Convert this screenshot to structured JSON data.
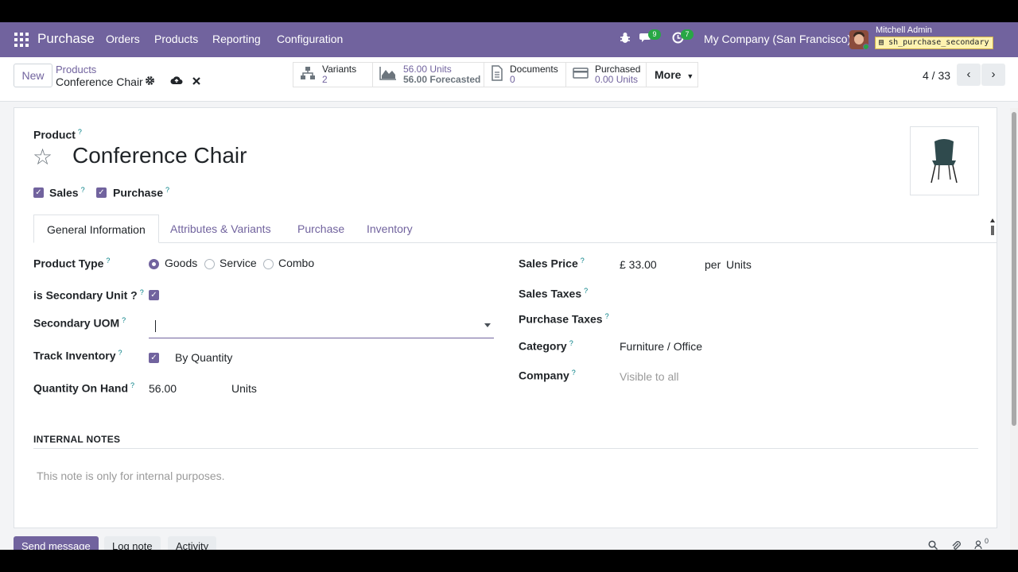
{
  "navbar": {
    "app_name": "Purchase",
    "menus": [
      "Orders",
      "Products",
      "Reporting",
      "Configuration"
    ],
    "messages_badge": "9",
    "activities_badge": "7",
    "company": "My Company (San Francisco)",
    "user_name": "Mitchell Admin",
    "db_name": "sh_purchase_secondary"
  },
  "control_panel": {
    "new_label": "New",
    "breadcrumb_parent": "Products",
    "breadcrumb_current": "Conference Chair",
    "stat_buttons": {
      "variants": {
        "l1": "Variants",
        "l2": "2"
      },
      "onhand": {
        "l1": "56.00 Units",
        "l2": "56.00 Forecasted"
      },
      "documents": {
        "l1": "Documents",
        "l2": "0"
      },
      "purchased": {
        "l1": "Purchased",
        "l2": "0.00 Units"
      }
    },
    "more_label": "More",
    "pager": "4 / 33"
  },
  "form": {
    "product_label": "Product",
    "product_name": "Conference Chair",
    "sales_label": "Sales",
    "purchase_label": "Purchase",
    "tabs": [
      "General Information",
      "Attributes & Variants",
      "Purchase",
      "Inventory"
    ],
    "product_type_label": "Product Type",
    "product_type_options": [
      "Goods",
      "Service",
      "Combo"
    ],
    "product_type_selected": "Goods",
    "secondary_unit_label": "is Secondary Unit ?",
    "secondary_uom_label": "Secondary UOM",
    "secondary_uom_value": "",
    "track_inventory_label": "Track Inventory",
    "track_inventory_value": "By Quantity",
    "qty_on_hand_label": "Quantity On Hand",
    "qty_on_hand_value": "56.00",
    "qty_on_hand_unit": "Units",
    "sales_price_label": "Sales Price",
    "sales_price_value": "£ 33.00",
    "sales_price_per": "per",
    "sales_price_unit": "Units",
    "sales_taxes_label": "Sales Taxes",
    "purchase_taxes_label": "Purchase Taxes",
    "category_label": "Category",
    "category_value": "Furniture / Office",
    "company_label": "Company",
    "company_placeholder": "Visible to all",
    "internal_notes_title": "INTERNAL NOTES",
    "internal_notes_placeholder": "This note is only for internal purposes."
  },
  "chatter": {
    "send_message": "Send message",
    "log_note": "Log note",
    "activity": "Activity",
    "followers_count": "0"
  },
  "colors": {
    "brand": "#71639e",
    "help": "#017e84",
    "badge": "#28a745"
  }
}
